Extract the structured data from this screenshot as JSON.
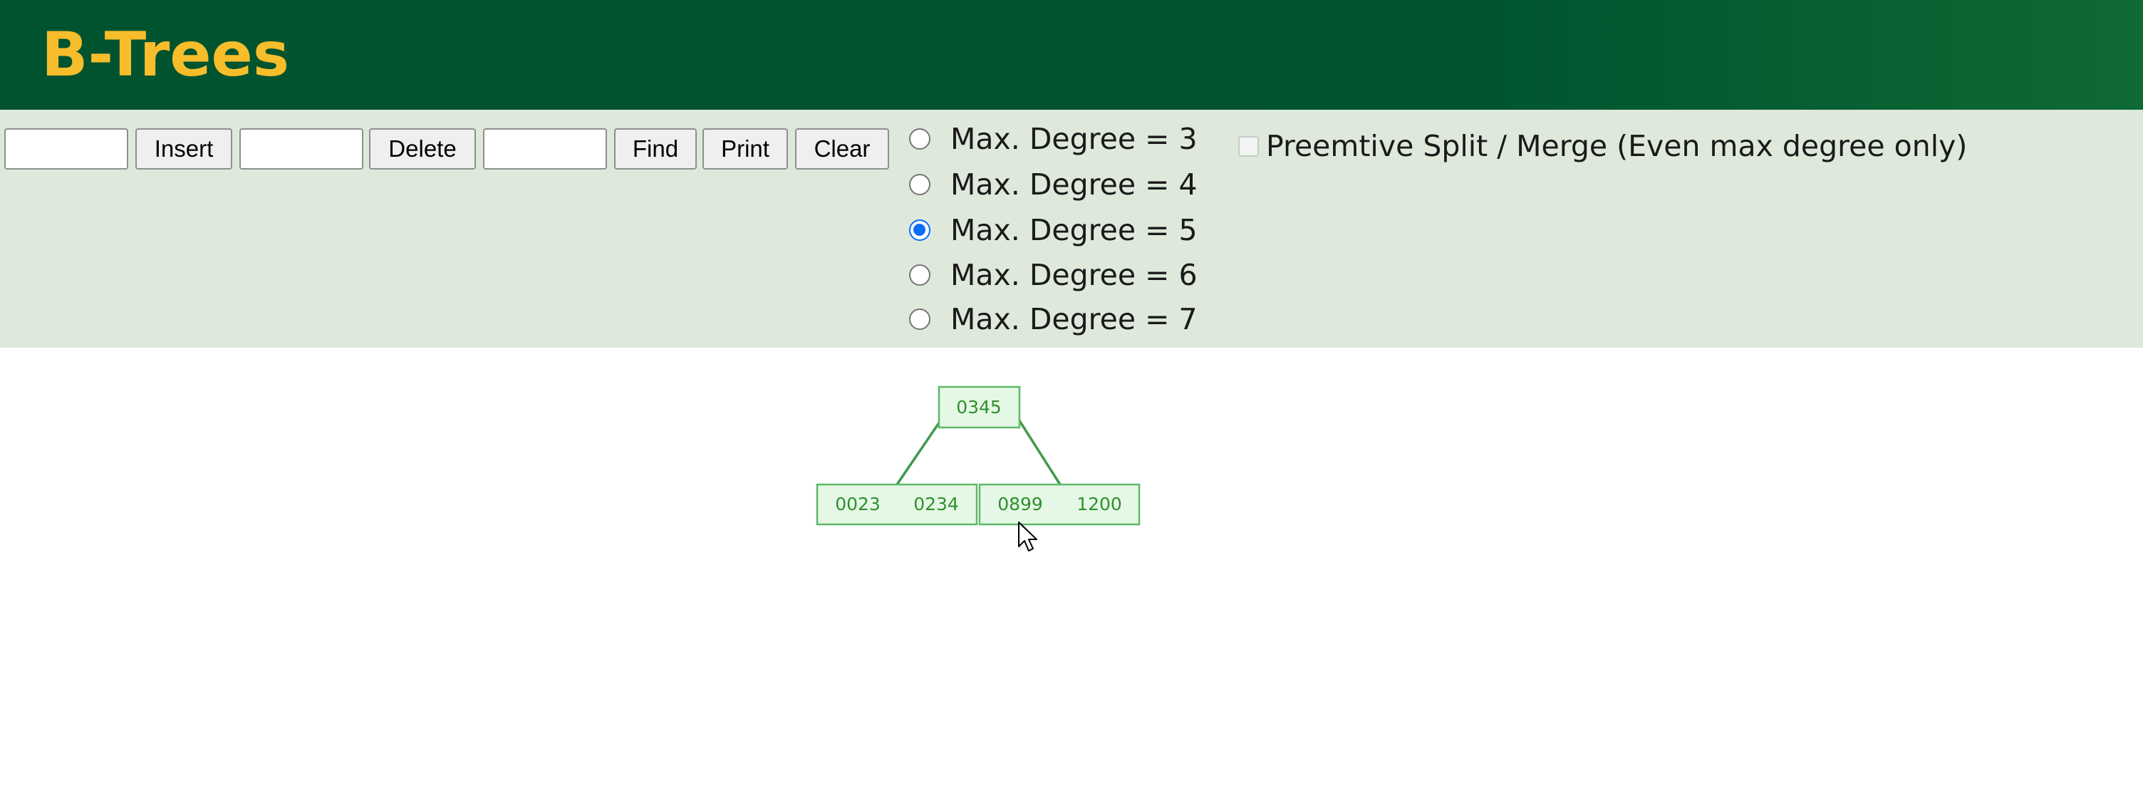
{
  "header": {
    "title": "B-Trees"
  },
  "toolbar": {
    "insert_value": "",
    "insert_label": "Insert",
    "delete_value": "",
    "delete_label": "Delete",
    "find_value": "",
    "find_label": "Find",
    "print_label": "Print",
    "clear_label": "Clear"
  },
  "degree_options": [
    {
      "label": "Max. Degree = 3",
      "selected": false
    },
    {
      "label": "Max. Degree = 4",
      "selected": false
    },
    {
      "label": "Max. Degree = 5",
      "selected": true
    },
    {
      "label": "Max. Degree = 6",
      "selected": false
    },
    {
      "label": "Max. Degree = 7",
      "selected": false
    }
  ],
  "preemptive": {
    "label": "Preemtive Split / Merge (Even max degree only)",
    "checked": false,
    "enabled": false
  },
  "tree": {
    "root": {
      "keys": [
        "0345"
      ]
    },
    "children": [
      {
        "keys": [
          "0023",
          "0234"
        ]
      },
      {
        "keys": [
          "0899",
          "1200"
        ]
      }
    ]
  },
  "colors": {
    "header_bg": "#00552f",
    "title_text": "#f7bd2b",
    "controls_bg": "#dee9dc",
    "node_fill": "#e5f8e5",
    "node_stroke": "#5fb86a",
    "edge": "#3f9a4c",
    "key_text": "#2f8f2f",
    "radio_selected": "#0b6cf5"
  },
  "icons": {
    "cursor": "mouse-pointer-icon"
  }
}
